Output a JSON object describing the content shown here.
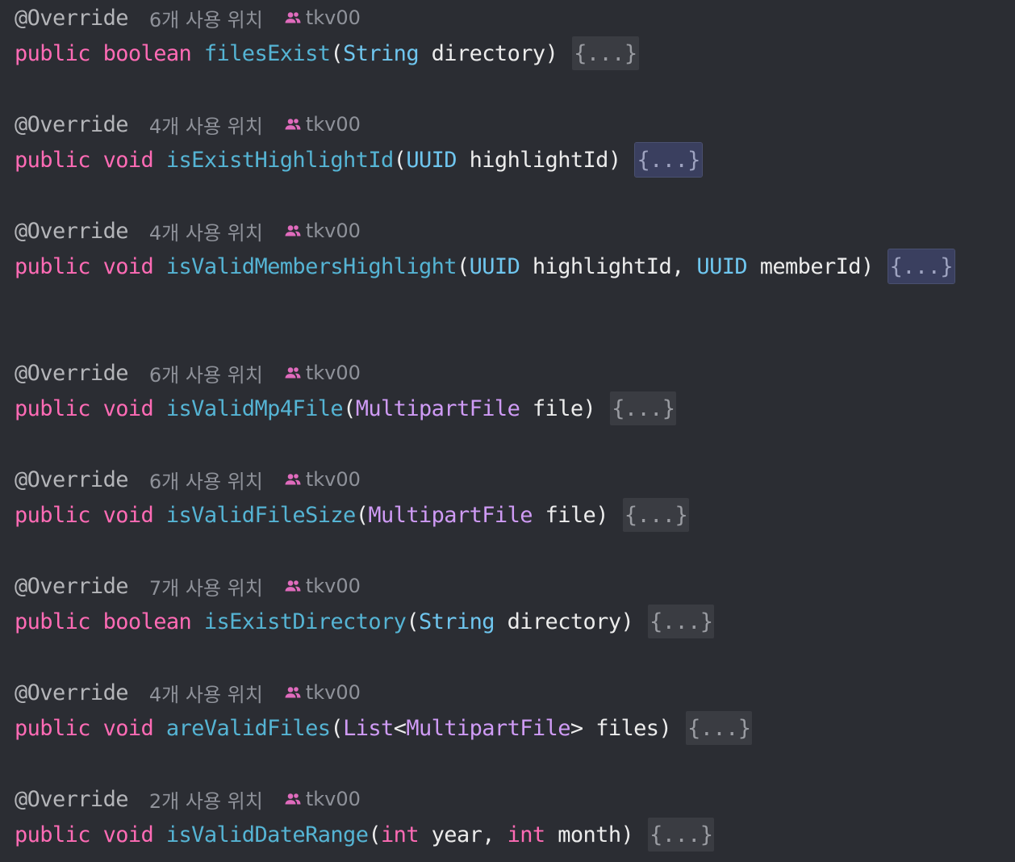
{
  "methods": [
    {
      "annotation": "@Override",
      "usage": "6개 사용 위치",
      "author": "tkv00",
      "modifier": "public",
      "return_type": "boolean",
      "name": "filesExist",
      "params": [
        {
          "type": "String",
          "type_kind": "type",
          "name": "directory"
        }
      ],
      "fold": "{...}",
      "fold_selected": false
    },
    {
      "annotation": "@Override",
      "usage": "4개 사용 위치",
      "author": "tkv00",
      "modifier": "public",
      "return_type": "void",
      "name": "isExistHighlightId",
      "params": [
        {
          "type": "UUID",
          "type_kind": "type",
          "name": "highlightId"
        }
      ],
      "fold": "{...}",
      "fold_selected": true
    },
    {
      "annotation": "@Override",
      "usage": "4개 사용 위치",
      "author": "tkv00",
      "modifier": "public",
      "return_type": "void",
      "name": "isValidMembersHighlight",
      "params": [
        {
          "type": "UUID",
          "type_kind": "type",
          "name": "highlightId"
        },
        {
          "type": "UUID",
          "type_kind": "type",
          "name": "memberId"
        }
      ],
      "fold": "{...}",
      "fold_selected": true
    },
    {
      "annotation": "@Override",
      "usage": "6개 사용 위치",
      "author": "tkv00",
      "modifier": "public",
      "return_type": "void",
      "name": "isValidMp4File",
      "params": [
        {
          "type": "MultipartFile",
          "type_kind": "class",
          "name": "file"
        }
      ],
      "fold": "{...}",
      "fold_selected": false
    },
    {
      "annotation": "@Override",
      "usage": "6개 사용 위치",
      "author": "tkv00",
      "modifier": "public",
      "return_type": "void",
      "name": "isValidFileSize",
      "params": [
        {
          "type": "MultipartFile",
          "type_kind": "class",
          "name": "file"
        }
      ],
      "fold": "{...}",
      "fold_selected": false
    },
    {
      "annotation": "@Override",
      "usage": "7개 사용 위치",
      "author": "tkv00",
      "modifier": "public",
      "return_type": "boolean",
      "name": "isExistDirectory",
      "params": [
        {
          "type": "String",
          "type_kind": "type",
          "name": "directory"
        }
      ],
      "fold": "{...}",
      "fold_selected": false
    },
    {
      "annotation": "@Override",
      "usage": "4개 사용 위치",
      "author": "tkv00",
      "modifier": "public",
      "return_type": "void",
      "name": "areValidFiles",
      "params": [
        {
          "type": "List<MultipartFile>",
          "type_kind": "generic",
          "generic_outer": "List",
          "generic_inner": "MultipartFile",
          "name": "files"
        }
      ],
      "fold": "{...}",
      "fold_selected": false
    },
    {
      "annotation": "@Override",
      "usage": "2개 사용 위치",
      "author": "tkv00",
      "modifier": "public",
      "return_type": "void",
      "name": "isValidDateRange",
      "params": [
        {
          "type": "int",
          "type_kind": "primitive",
          "name": "year"
        },
        {
          "type": "int",
          "type_kind": "primitive",
          "name": "month"
        }
      ],
      "fold": "{...}",
      "fold_selected": false
    }
  ],
  "colors": {
    "background": "#2b2d33",
    "keyword": "#ff6bb5",
    "method_name": "#55b4d4",
    "type": "#6fc6ef",
    "class": "#cf9bf5",
    "hint": "#8f929a",
    "author_icon": "#e06bbd"
  },
  "icons": {
    "author": "people-icon"
  }
}
